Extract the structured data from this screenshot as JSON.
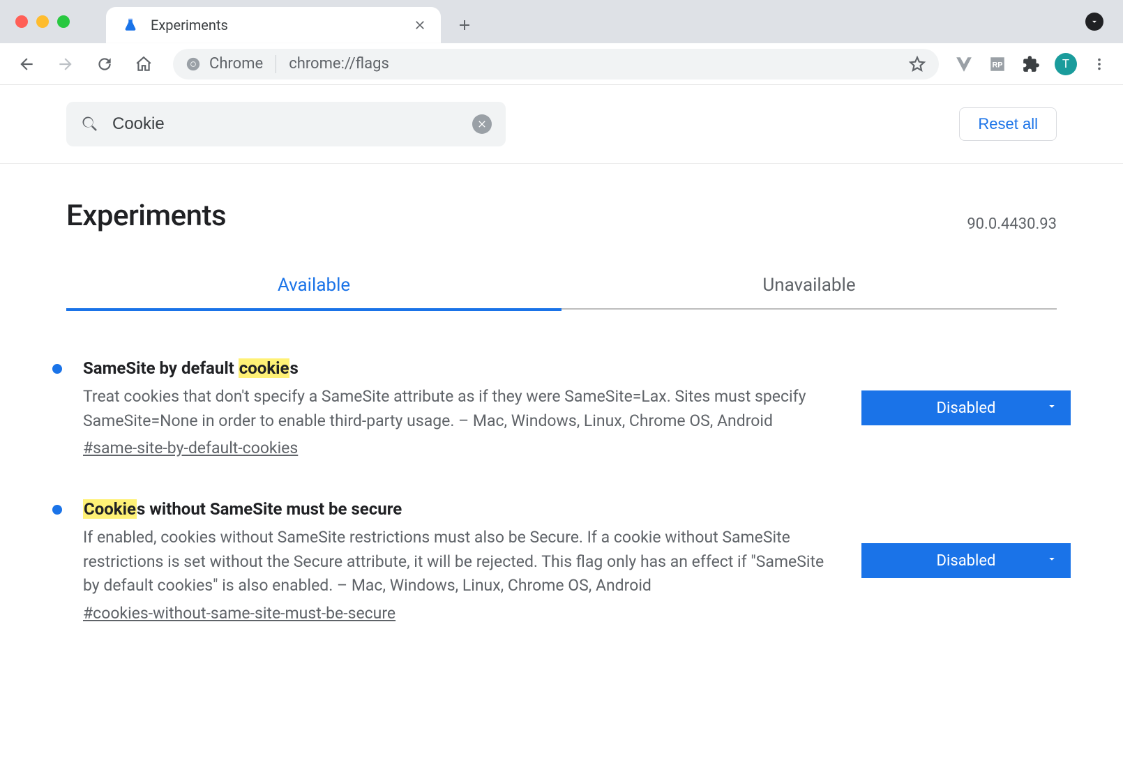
{
  "browser": {
    "tab_title": "Experiments",
    "omnibox_label": "Chrome",
    "omnibox_url": "chrome://flags",
    "profile_initial": "T"
  },
  "search": {
    "value": "Cookie",
    "reset_label": "Reset all"
  },
  "page": {
    "title": "Experiments",
    "version": "90.0.4430.93"
  },
  "tabs": {
    "available": "Available",
    "unavailable": "Unavailable"
  },
  "flags": [
    {
      "title_pre": "SameSite by default ",
      "title_hl": "cookie",
      "title_post": "s",
      "description": "Treat cookies that don't specify a SameSite attribute as if they were SameSite=Lax. Sites must specify SameSite=None in order to enable third-party usage. – Mac, Windows, Linux, Chrome OS, Android",
      "anchor": "#same-site-by-default-cookies",
      "select": "Disabled"
    },
    {
      "title_pre": "",
      "title_hl": "Cookie",
      "title_post": "s without SameSite must be secure",
      "description": "If enabled, cookies without SameSite restrictions must also be Secure. If a cookie without SameSite restrictions is set without the Secure attribute, it will be rejected. This flag only has an effect if \"SameSite by default cookies\" is also enabled. – Mac, Windows, Linux, Chrome OS, Android",
      "anchor": "#cookies-without-same-site-must-be-secure",
      "select": "Disabled"
    }
  ]
}
